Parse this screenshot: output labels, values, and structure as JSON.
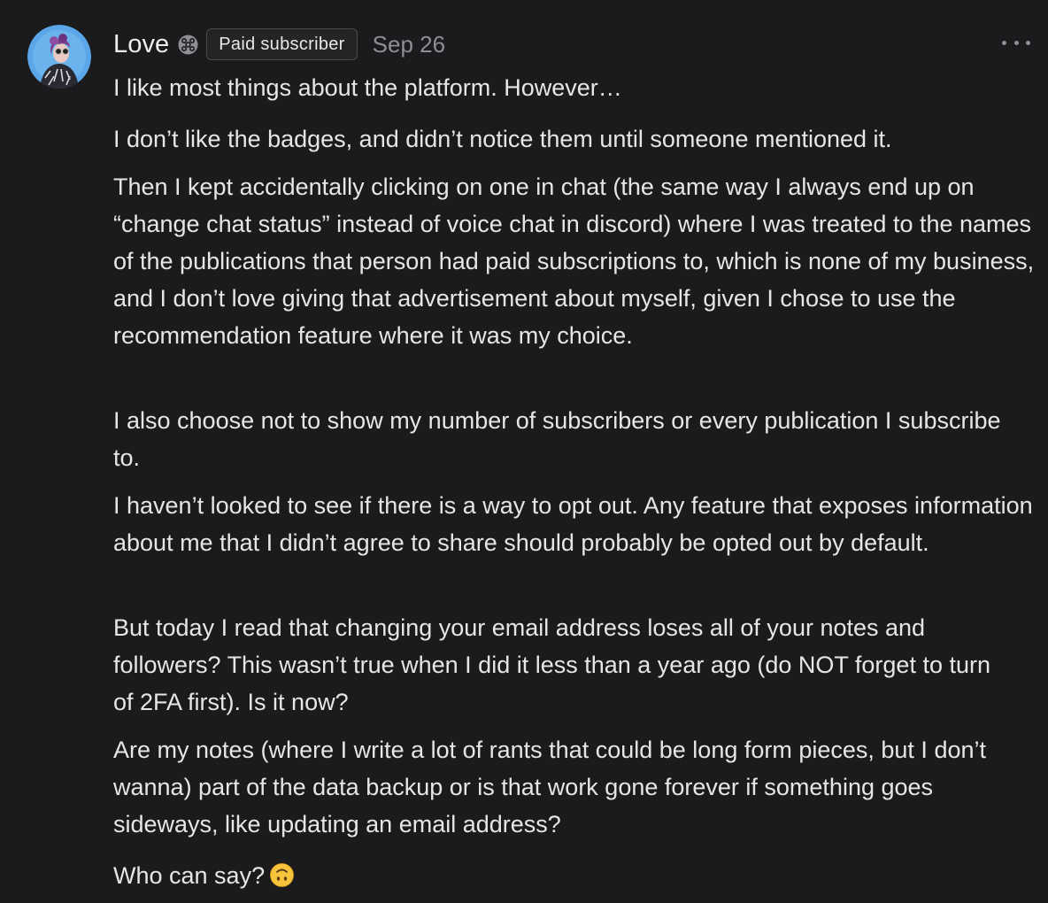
{
  "comment": {
    "author": {
      "name": "Love",
      "subscriber_icon": "subscriber-icon",
      "badge": "Paid subscriber"
    },
    "timestamp": "Sep 26",
    "menu_icon": "more-icon",
    "paragraphs": [
      "I like most things about the platform. However…",
      "I don’t like the badges, and didn’t notice them until someone mentioned it.",
      "Then I kept accidentally clicking on one in chat (the same way I always end up on “change chat status” instead of voice chat in discord) where I was treated to the names of the publications that person had paid subscriptions to, which is none of my business, and I don’t love giving that advertisement about myself, given I chose to use the recommendation feature where it was my choice.",
      "I also choose not to show my number of subscribers or every publication I subscribe to.",
      "I haven’t looked to see if there is a way to opt out. Any feature that exposes information about me that I didn’t agree to share should probably be opted out by default.",
      "But today I read that changing your email address loses all of your notes and followers? This wasn’t true when I did it less than a year ago (do NOT forget to turn of 2FA first). Is it now?",
      "Are my notes (where I write a lot of rants that could be long form pieces, but I don’t wanna) part of the data backup or is that work gone forever if something goes sideways, like updating an email address?",
      "Who can say?"
    ],
    "emoji": "upside-down-face-emoji"
  },
  "colors": {
    "background": "#1b1b1d",
    "text": "#e6e6e6",
    "muted": "#8e8e93",
    "badge_border": "#4a4a4c",
    "avatar_bg": "#5aa6e8"
  }
}
